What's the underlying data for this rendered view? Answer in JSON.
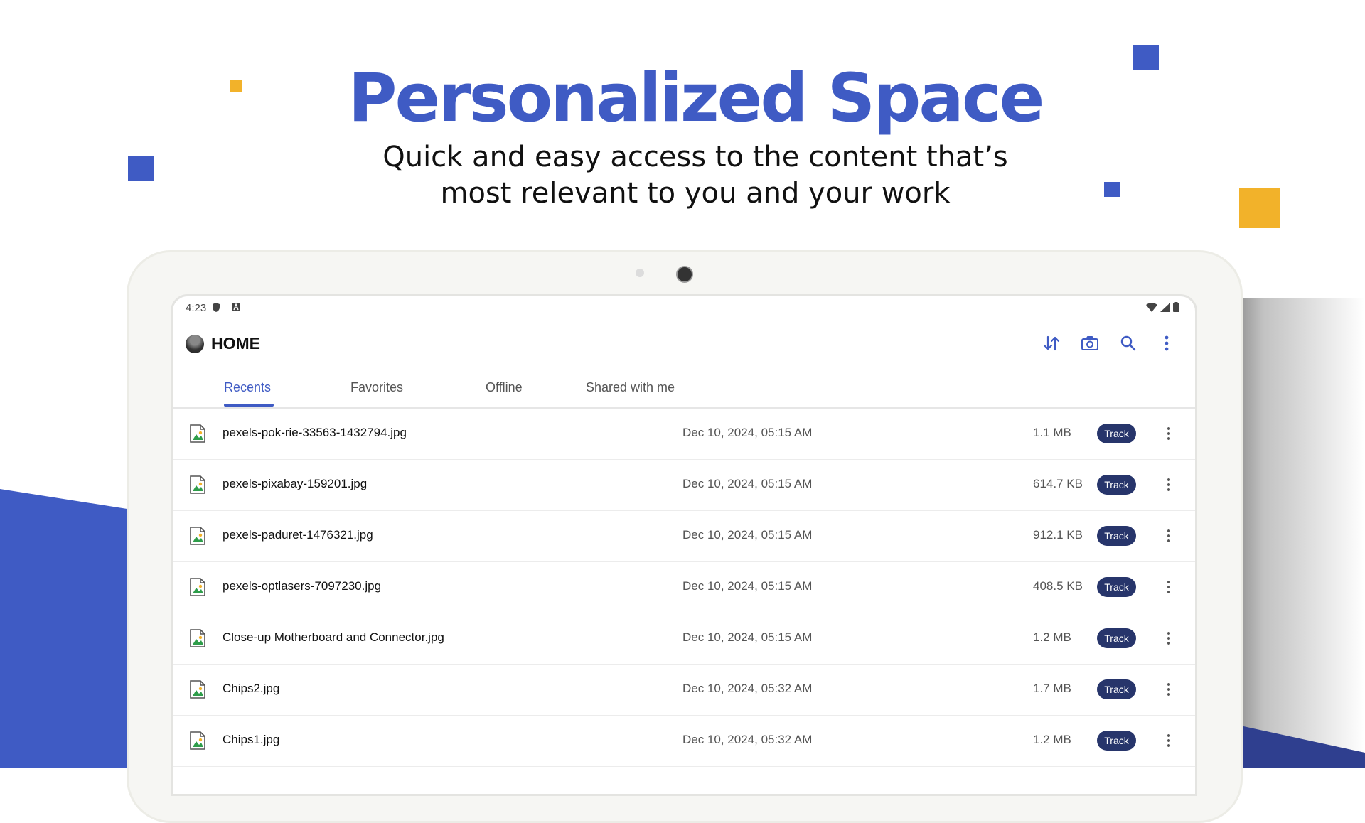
{
  "hero": {
    "title": "Personalized Space",
    "subtitle_line1": "Quick and easy access to the content that’s",
    "subtitle_line2": "most relevant to you and your work"
  },
  "colors": {
    "brand_blue": "#3f5bc4",
    "accent_yellow": "#f2b22a",
    "track_badge": "#27356b"
  },
  "statusbar": {
    "time": "4:23",
    "left_icons": [
      "shield-icon",
      "a-icon"
    ],
    "right_icons": [
      "wifi-icon",
      "signal-icon",
      "battery-icon"
    ]
  },
  "appbar": {
    "title": "HOME",
    "actions": [
      "sort-icon",
      "camera-icon",
      "search-icon",
      "more-vertical-icon"
    ]
  },
  "tabs": [
    {
      "label": "Recents",
      "active": true
    },
    {
      "label": "Favorites",
      "active": false
    },
    {
      "label": "Offline",
      "active": false
    },
    {
      "label": "Shared with me",
      "active": false
    }
  ],
  "files": [
    {
      "name": "pexels-pok-rie-33563-1432794.jpg",
      "date": "Dec 10, 2024, 05:15 AM",
      "size": "1.1 MB",
      "badge": "Track"
    },
    {
      "name": "pexels-pixabay-159201.jpg",
      "date": "Dec 10, 2024, 05:15 AM",
      "size": "614.7 KB",
      "badge": "Track"
    },
    {
      "name": "pexels-paduret-1476321.jpg",
      "date": "Dec 10, 2024, 05:15 AM",
      "size": "912.1 KB",
      "badge": "Track"
    },
    {
      "name": "pexels-optlasers-7097230.jpg",
      "date": "Dec 10, 2024, 05:15 AM",
      "size": "408.5 KB",
      "badge": "Track"
    },
    {
      "name": "Close-up Motherboard and Connector.jpg",
      "date": "Dec 10, 2024, 05:15 AM",
      "size": "1.2 MB",
      "badge": "Track"
    },
    {
      "name": "Chips2.jpg",
      "date": "Dec 10, 2024, 05:32 AM",
      "size": "1.7 MB",
      "badge": "Track"
    },
    {
      "name": "Chips1.jpg",
      "date": "Dec 10, 2024, 05:32 AM",
      "size": "1.2 MB",
      "badge": "Track"
    }
  ]
}
